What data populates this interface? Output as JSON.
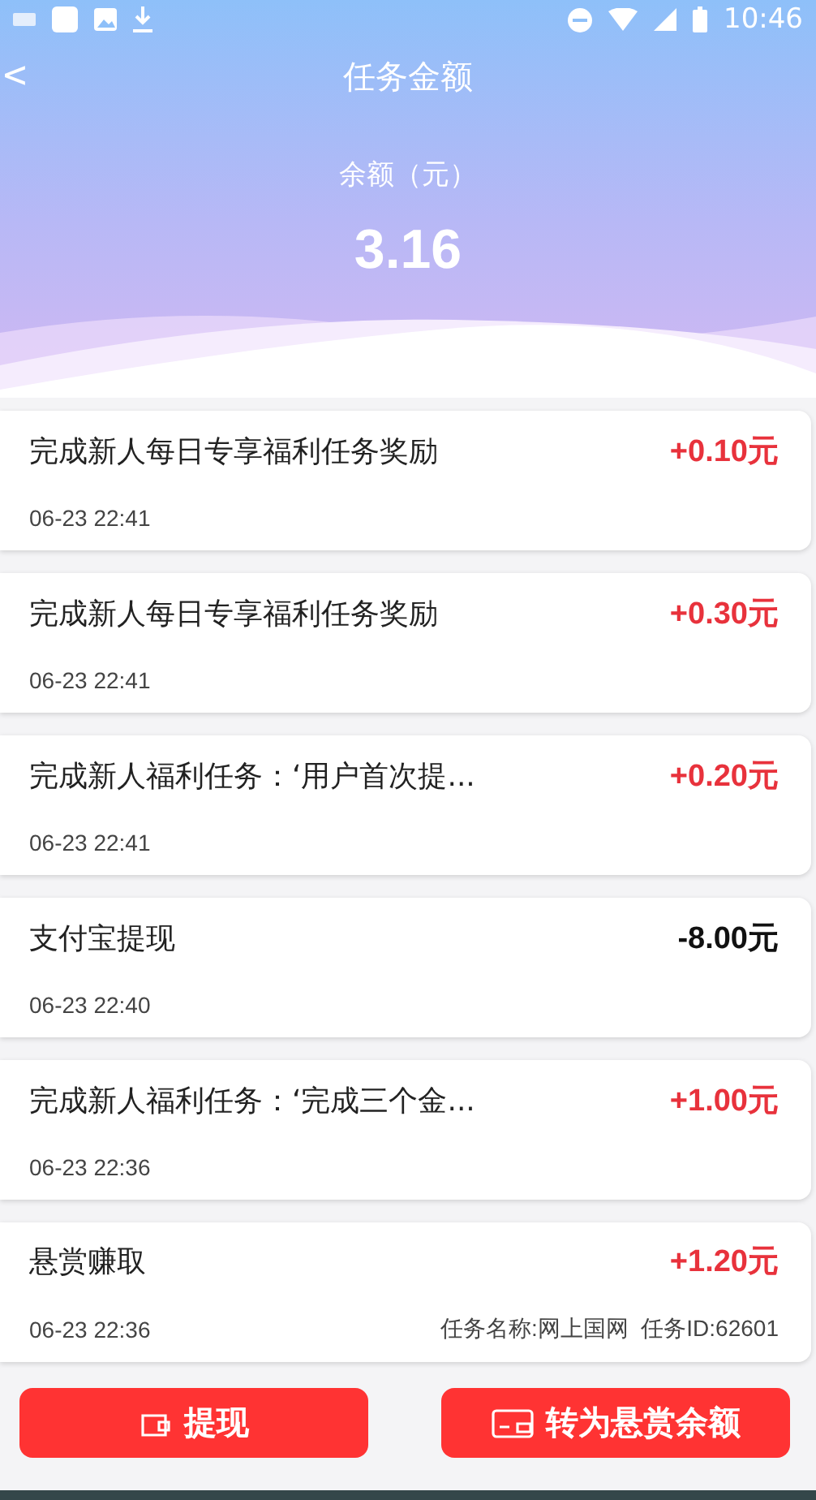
{
  "status_bar": {
    "time": "10:46"
  },
  "nav": {
    "back": "<",
    "title": "任务金额"
  },
  "balance": {
    "label": "余额（元）",
    "value": "3.16"
  },
  "records": [
    {
      "title": "完成新人每日专享福利任务奖励",
      "time": "06-23 22:41",
      "amount": "+0.10元",
      "kind": "income"
    },
    {
      "title": "完成新人每日专享福利任务奖励",
      "time": "06-23 22:41",
      "amount": "+0.30元",
      "kind": "income"
    },
    {
      "title": "完成新人福利任务：‘用户首次提...",
      "time": "06-23 22:41",
      "amount": "+0.20元",
      "kind": "income"
    },
    {
      "title": "支付宝提现",
      "time": "06-23 22:40",
      "amount": "-8.00元",
      "kind": "expense"
    },
    {
      "title": "完成新人福利任务：‘完成三个金...",
      "time": "06-23 22:36",
      "amount": "+1.00元",
      "kind": "income"
    },
    {
      "title": "悬赏赚取",
      "time": "06-23 22:36",
      "amount": "+1.20元",
      "kind": "income",
      "detail": "任务名称:网上国网  任务ID:62601"
    }
  ],
  "buttons": [
    {
      "label": "提现",
      "kind": "wallet"
    },
    {
      "label": "转为悬赏余额",
      "kind": "card"
    }
  ]
}
